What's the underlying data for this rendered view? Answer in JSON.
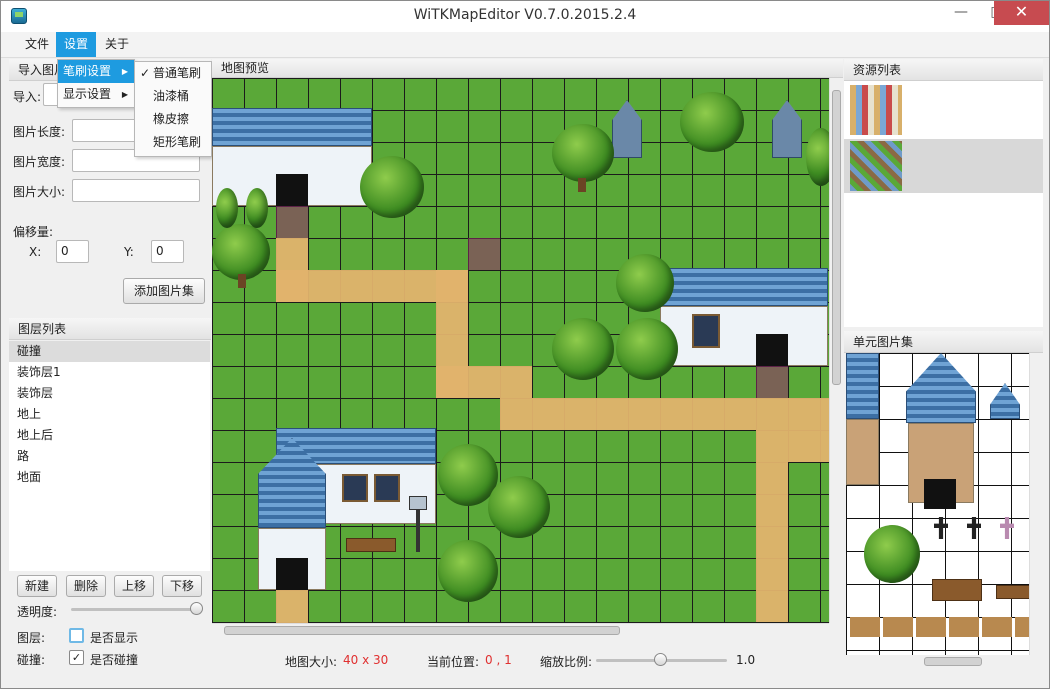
{
  "window": {
    "title": "WiTKMapEditor V0.7.0.2015.2.4",
    "minimize": "—",
    "maximize": "□",
    "close": "✕"
  },
  "menubar": {
    "file": "文件",
    "settings": "设置",
    "about": "关于"
  },
  "settings_menu": {
    "brush_settings": "笔刷设置",
    "display_settings": "显示设置"
  },
  "brush_menu": {
    "check": "✓",
    "normal": "普通笔刷",
    "bucket": "油漆桶",
    "eraser": "橡皮擦",
    "rect": "矩形笔刷"
  },
  "import_panel": {
    "header": "导入图片",
    "import_label": "导入:",
    "import_value": "",
    "width_label": "图片长度:",
    "height_label": "图片宽度:",
    "size_label": "图片大小:",
    "width_value": "",
    "height_value": "",
    "size_value": "",
    "offset_label": "偏移量:",
    "x_label": "X:",
    "x_value": "0",
    "y_label": "Y:",
    "y_value": "0",
    "add_button": "添加图片集"
  },
  "layer_panel": {
    "header": "图层列表",
    "layers": [
      "碰撞",
      "装饰层1",
      "装饰层",
      "地上",
      "地上后",
      "路",
      "地面"
    ],
    "new": "新建",
    "delete": "删除",
    "up": "上移",
    "down": "下移",
    "opacity_label": "透明度:",
    "opacity": 1.0,
    "layer_label": "图层:",
    "show_label": "是否显示",
    "show_checked": false,
    "collision_label": "碰撞:",
    "collision_text": "是否碰撞",
    "collision_checked": true,
    "check_mark": "✓"
  },
  "map_panel": {
    "header": "地图预览"
  },
  "status": {
    "size_label": "地图大小:",
    "size_value": "40 x 30",
    "pos_label": "当前位置:",
    "pos_value": "0 , 1",
    "zoom_label": "缩放比例:",
    "zoom_value": "1.0"
  },
  "resource_panel": {
    "header": "资源列表"
  },
  "tile_panel": {
    "header": "单元图片集"
  },
  "colors": {
    "accent": "#1e9be0",
    "grass": "#5aa838",
    "path": "#e1b36d",
    "highlight": "#962870",
    "value_red": "#e03030"
  }
}
